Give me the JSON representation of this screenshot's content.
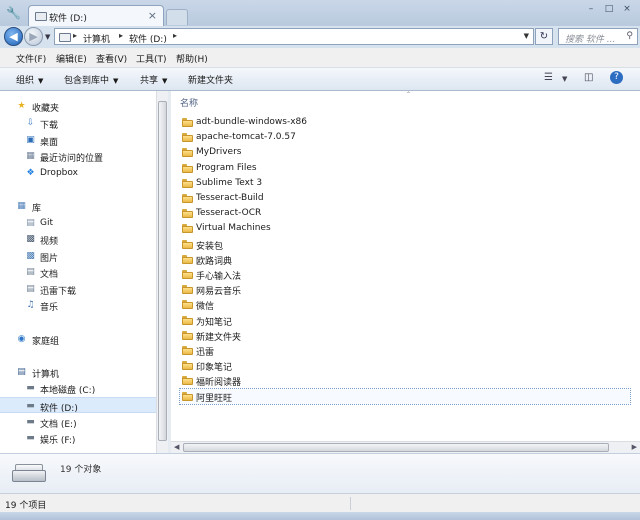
{
  "window": {
    "tab_title": "软件 (D:)",
    "close_glyph": "×",
    "wrench_glyph": "🔧",
    "ctl_min": "–",
    "ctl_max": "□",
    "ctl_close": "×"
  },
  "address": {
    "crumbs": [
      "计算机",
      "软件 (D:)"
    ],
    "search_placeholder": "搜索 软件 ..."
  },
  "menu": [
    "文件(F)",
    "编辑(E)",
    "查看(V)",
    "工具(T)",
    "帮助(H)"
  ],
  "commands": {
    "organize": "组织",
    "include_in_library": "包含到库中",
    "share": "共享",
    "new_folder": "新建文件夹"
  },
  "nav": {
    "favorites": {
      "header": "收藏夹",
      "items": [
        "下载",
        "桌面",
        "最近访问的位置",
        "Dropbox"
      ]
    },
    "libraries": {
      "header": "库",
      "items": [
        "Git",
        "视频",
        "图片",
        "文档",
        "迅雷下载",
        "音乐"
      ]
    },
    "homegroup": "家庭组",
    "computer": {
      "header": "计算机",
      "items": [
        "本地磁盘 (C:)",
        "软件 (D:)",
        "文档 (E:)",
        "娱乐 (F:)"
      ],
      "selected": "软件 (D:)"
    }
  },
  "file_list": {
    "column_name": "名称",
    "items": [
      "adt-bundle-windows-x86",
      "apache-tomcat-7.0.57",
      "MyDrivers",
      "Program Files",
      "Sublime Text 3",
      "Tesseract-Build",
      "Tesseract-OCR",
      "Virtual Machines",
      "安装包",
      "欧路词典",
      "手心输入法",
      "网易云音乐",
      "微信",
      "为知笔记",
      "新建文件夹",
      "迅雷",
      "印象笔记",
      "福昕阅读器",
      "阿里旺旺"
    ],
    "focused": "阿里旺旺"
  },
  "details": {
    "count": "19 个对象"
  },
  "status": {
    "text": "19 个项目"
  },
  "colors": {
    "selection": "#dcebfc",
    "folder": "#f0c75a",
    "accent": "#1c5fb5"
  }
}
